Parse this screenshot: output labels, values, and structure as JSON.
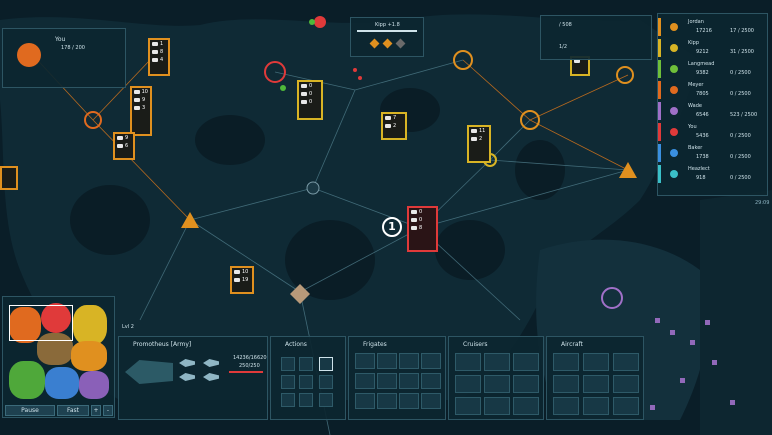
{
  "colors": {
    "orange": "#e0901f",
    "red": "#e03a3a",
    "yellow": "#d8b425",
    "purple": "#a070c8",
    "water": "#0a1e28",
    "land": "#10303c"
  },
  "top_left_panel": {
    "player": "You",
    "progress": "178 / 200"
  },
  "top_center_panel": {
    "label": "Kipp +1.8"
  },
  "top_right_panel": {
    "row1": "/ 508",
    "row2": "1/2"
  },
  "timer": "29:09",
  "scoreboard": [
    {
      "name": "Jordan",
      "power": "17216",
      "score": "17 / 2500",
      "color": "#e0901f"
    },
    {
      "name": "Kipp",
      "power": "9212",
      "score": "31 / 2500",
      "color": "#d8b425"
    },
    {
      "name": "Langmead",
      "power": "9382",
      "score": "0 / 2500",
      "color": "#6fbf3a"
    },
    {
      "name": "Meyer",
      "power": "7805",
      "score": "0 / 2500",
      "color": "#e06a1f"
    },
    {
      "name": "Wade",
      "power": "6546",
      "score": "523 / 2500",
      "color": "#a070c8"
    },
    {
      "name": "You",
      "power": "5436",
      "score": "0 / 2500",
      "color": "#e03a3a"
    },
    {
      "name": "Baker",
      "power": "1738",
      "score": "0 / 2500",
      "color": "#3a8fe0"
    },
    {
      "name": "Heazlect",
      "power": "918",
      "score": "0 / 2500",
      "color": "#3ac0c8"
    }
  ],
  "badge_main": {
    "number": "1",
    "rows": [
      "0",
      "0",
      "8"
    ]
  },
  "badges": [
    {
      "rows": [
        "1",
        "8",
        "4"
      ]
    },
    {
      "rows": [
        "10",
        "9",
        "3"
      ]
    },
    {
      "rows": [
        "9",
        "6",
        "4"
      ]
    },
    {
      "rows": [
        "11",
        "2"
      ]
    },
    {
      "rows": [
        "7",
        "2"
      ]
    },
    {
      "rows": [
        "0",
        "0",
        "0"
      ]
    },
    {
      "rows": [
        "10",
        "19"
      ]
    },
    {
      "rows": [
        "11",
        "5",
        "5"
      ]
    }
  ],
  "minimap": {
    "label": "Lvl 2",
    "pause": "Pause",
    "speed": "Fast",
    "plus": "+",
    "minus": "-"
  },
  "army_panel": {
    "title": "Promotheus [Army]",
    "stat1": "14236/16620",
    "stat2": "250/250"
  },
  "actions_panel": {
    "title": "Actions"
  },
  "frigates_panel": {
    "title": "Frigates"
  },
  "cruisers_panel": {
    "title": "Cruisers"
  },
  "aircraft_panel": {
    "title": "Aircraft"
  }
}
